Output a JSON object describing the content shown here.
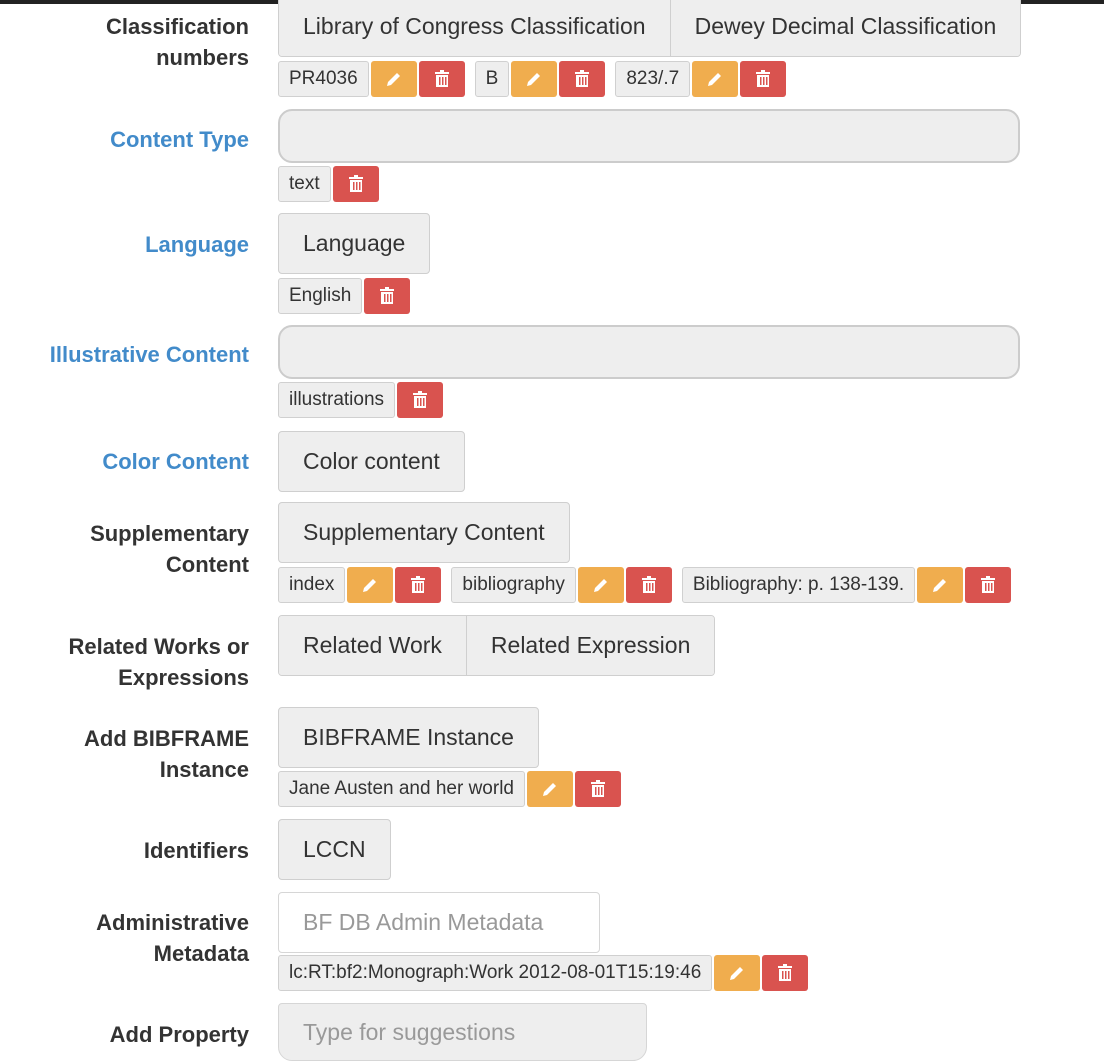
{
  "rows": {
    "classification": {
      "label_line1": "Classification",
      "label_line2": "numbers",
      "options": [
        "Library of Congress Classification",
        "Dewey Decimal Classification"
      ],
      "values": [
        "PR4036",
        "B",
        "823/.7"
      ]
    },
    "content_type": {
      "label": "Content Type",
      "value": "text"
    },
    "language": {
      "label": "Language",
      "button": "Language",
      "value": "English"
    },
    "illustrative": {
      "label": "Illustrative Content",
      "value": "illustrations"
    },
    "color": {
      "label": "Color Content",
      "button": "Color content"
    },
    "supplementary": {
      "label_line1": "Supplementary",
      "label_line2": "Content",
      "button": "Supplementary Content",
      "values": [
        "index",
        "bibliography",
        "Bibliography: p. 138-139."
      ]
    },
    "related": {
      "label_line1": "Related Works or",
      "label_line2": "Expressions",
      "options": [
        "Related Work",
        "Related Expression"
      ]
    },
    "instance": {
      "label_line1": "Add BIBFRAME",
      "label_line2": "Instance",
      "button": "BIBFRAME Instance",
      "value": "Jane Austen and her world"
    },
    "identifiers": {
      "label": "Identifiers",
      "button": "LCCN"
    },
    "admin": {
      "label_line1": "Administrative",
      "label_line2": "Metadata",
      "placeholder": "BF DB Admin Metadata",
      "value": "lc:RT:bf2:Monograph:Work 2012-08-01T15:19:46"
    },
    "add_property": {
      "label": "Add Property",
      "placeholder": "Type for suggestions"
    }
  },
  "icons": {
    "edit": "pencil-icon",
    "delete": "trash-icon"
  },
  "colors": {
    "label_link": "#428bca",
    "edit": "#f0ad4e",
    "delete": "#d9534f",
    "button_bg": "#eeeeee"
  }
}
